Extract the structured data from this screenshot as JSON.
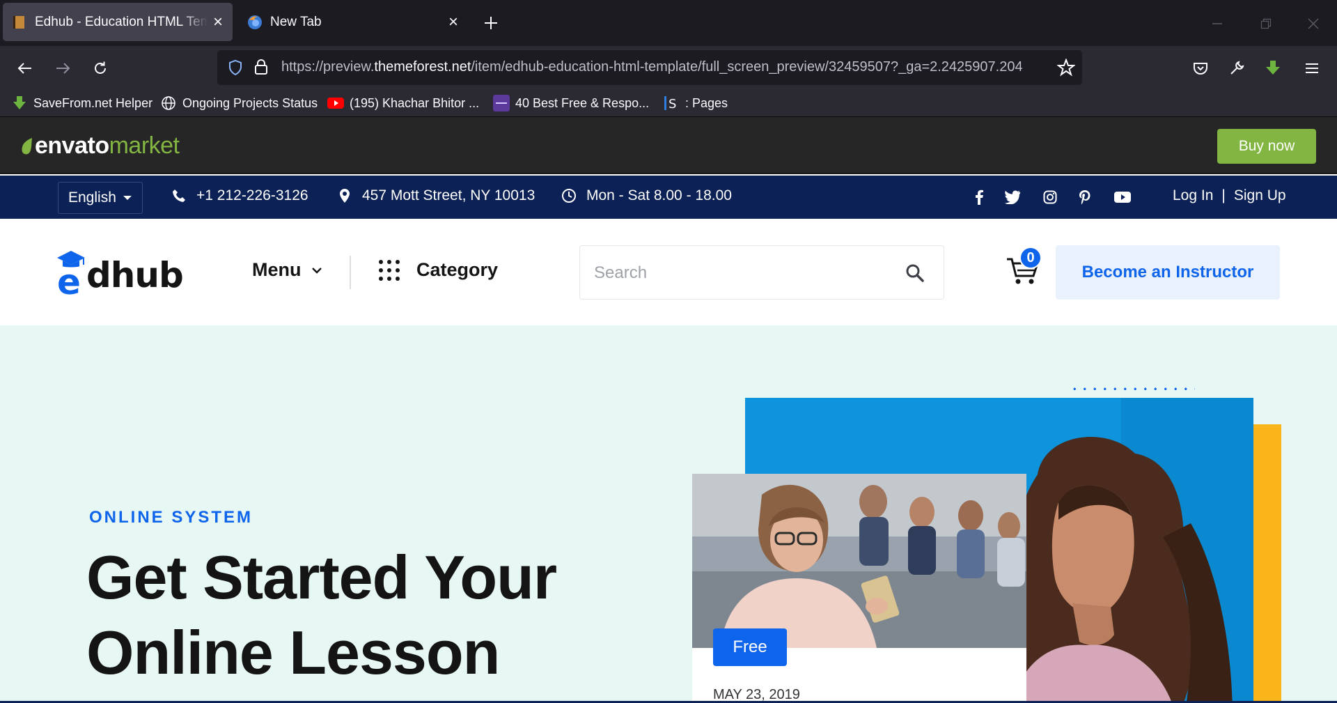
{
  "browser": {
    "tabs": [
      {
        "title": "Edhub - Education HTML Template",
        "active": true
      },
      {
        "title": "New Tab",
        "active": false
      }
    ],
    "url": {
      "prefix": "https://preview.",
      "domain": "themeforest.net",
      "path": "/item/edhub-education-html-template/full_screen_preview/32459507?_ga=2.2425907.204"
    },
    "bookmarks": [
      {
        "label": "SaveFrom.net Helper",
        "icon": "download-arrow-icon"
      },
      {
        "label": "Ongoing Projects Status",
        "icon": "globe-icon"
      },
      {
        "label": "(195) Khachar Bhitor ...",
        "icon": "youtube-icon"
      },
      {
        "label": "40 Best Free & Respo...",
        "icon": "colorlib-icon"
      },
      {
        "label": ": Pages",
        "icon": "s-logo-icon"
      }
    ]
  },
  "envato": {
    "logo_bold": "envato",
    "logo_light": "market",
    "buy_label": "Buy now"
  },
  "topbar": {
    "language": "English",
    "phone": "+1 212-226-3126",
    "address": "457 Mott Street, NY 10013",
    "hours": "Mon - Sat 8.00 - 18.00",
    "social": [
      "facebook-icon",
      "twitter-icon",
      "instagram-icon",
      "pinterest-icon",
      "youtube-icon"
    ],
    "login": "Log In",
    "separator": "|",
    "signup": "Sign Up"
  },
  "header": {
    "logo_text": "dhub",
    "logo_letter": "e",
    "menu": "Menu",
    "category": "Category",
    "search_placeholder": "Search",
    "cart_count": "0",
    "cta": "Become an Instructor"
  },
  "hero": {
    "eyebrow": "ONLINE SYSTEM",
    "headline_line1": "Get Started Your",
    "headline_line2": "Online Lesson",
    "card": {
      "badge": "Free",
      "date": "MAY 23, 2019"
    }
  },
  "colors": {
    "accent": "#0f64ec",
    "envato_green": "#82b541",
    "topbar_navy": "#0c2155",
    "hero_bg": "#e7f7f4",
    "hero_blue": "#0d94dc",
    "hero_yellow": "#f9b51a"
  }
}
